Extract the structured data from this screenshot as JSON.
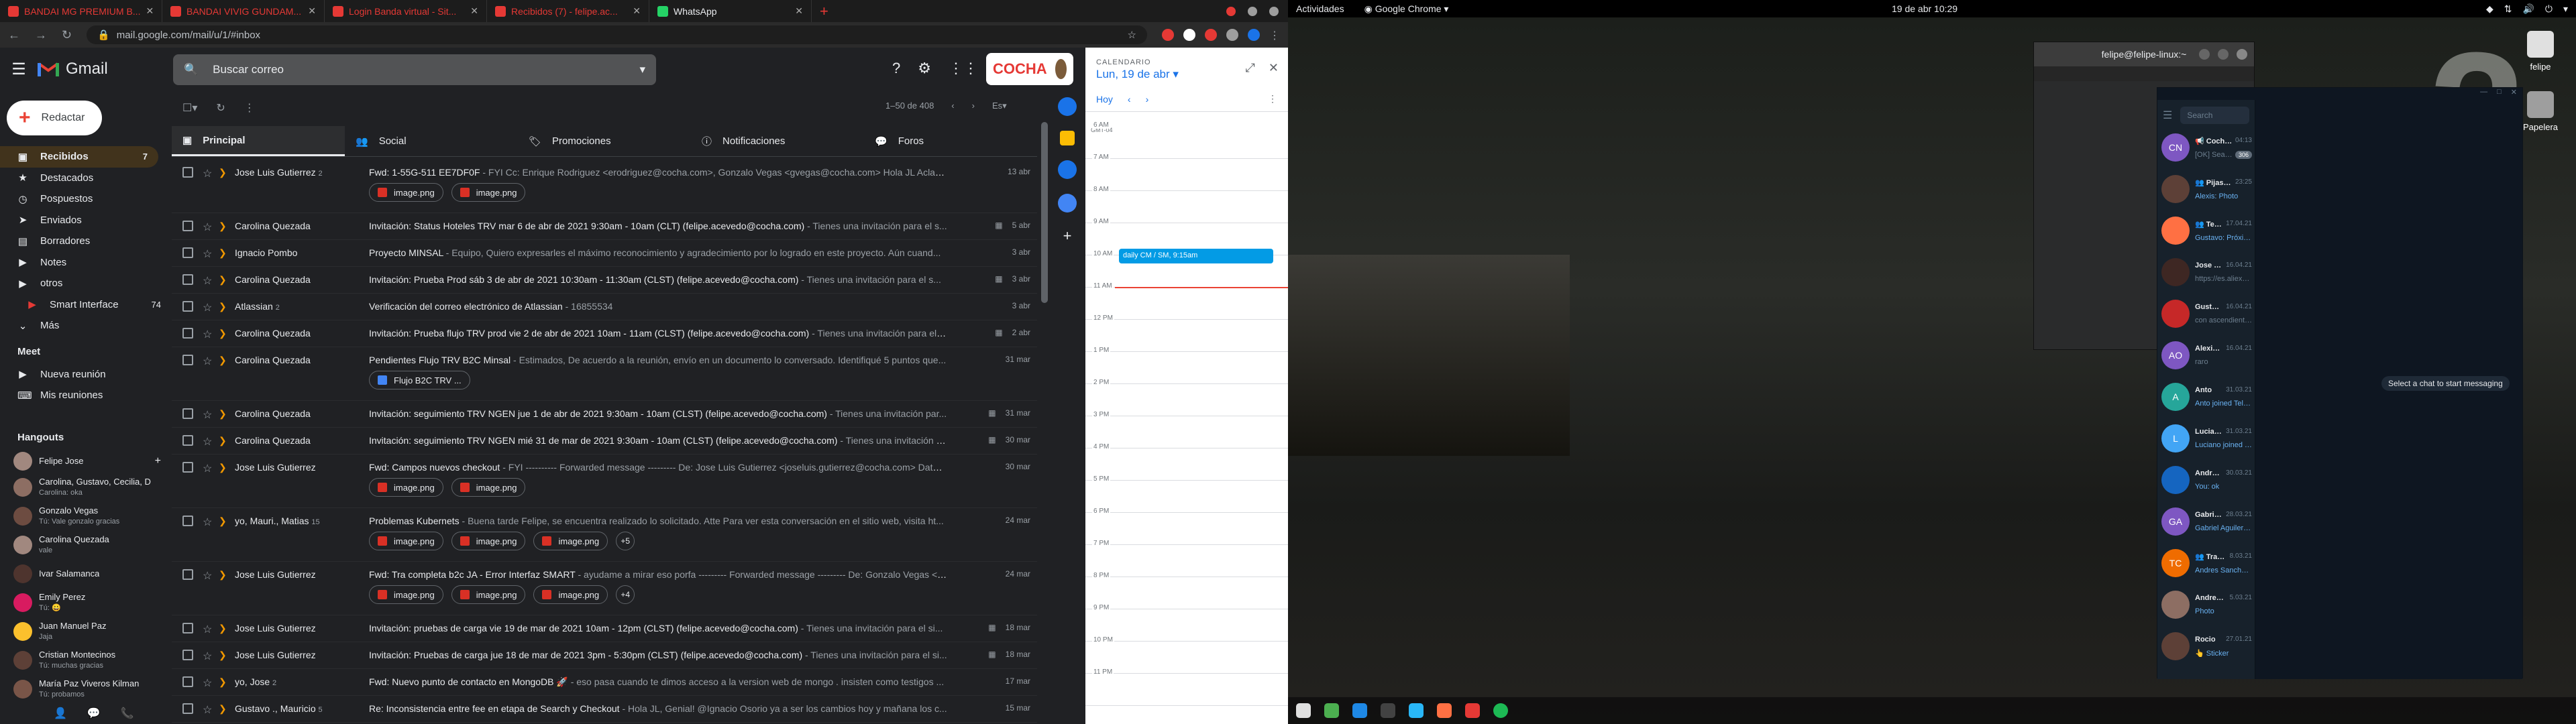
{
  "chrome": {
    "tabs": [
      {
        "label": "BANDAI MG PREMIUM B...",
        "color": "#e53935"
      },
      {
        "label": "BANDAI VIVIG GUNDAM...",
        "color": "#e53935"
      },
      {
        "label": "Login Banda virtual - Sit...",
        "color": "#e53935"
      },
      {
        "label": "Recibidos (7) - felipe.ac...",
        "color": "#e53935"
      },
      {
        "label": "WhatsApp",
        "color": "#25d366"
      }
    ],
    "new_tab": "+",
    "url": "mail.google.com/mail/u/1/#inbox"
  },
  "gmail": {
    "brand": "Gmail",
    "search_placeholder": "Buscar correo",
    "account_label": "COCHA",
    "compose": "Redactar",
    "nav": [
      {
        "label": "Recibidos",
        "icon": "inbox-icon",
        "count": "7",
        "active": true
      },
      {
        "label": "Destacados",
        "icon": "star-icon",
        "count": ""
      },
      {
        "label": "Pospuestos",
        "icon": "clock-icon",
        "count": ""
      },
      {
        "label": "Enviados",
        "icon": "send-icon",
        "count": ""
      },
      {
        "label": "Borradores",
        "icon": "draft-icon",
        "count": ""
      },
      {
        "label": "Notes",
        "icon": "label-icon",
        "count": ""
      },
      {
        "label": "otros",
        "icon": "label-icon",
        "count": ""
      },
      {
        "label": "Smart Interface",
        "icon": "label-red-icon",
        "count": "74"
      },
      {
        "label": "Más",
        "icon": "chevron-down-icon",
        "count": ""
      }
    ],
    "meet": {
      "title": "Meet",
      "items": [
        "Nueva reunión",
        "Mis reuniones"
      ]
    },
    "hangouts": {
      "title": "Hangouts",
      "user": "Felipe Jose",
      "contacts": [
        {
          "name": "Carolina, Gustavo, Cecilia, D",
          "status": "Carolina: oka",
          "color": "#8d6e63"
        },
        {
          "name": "Gonzalo Vegas",
          "status": "Tú: Vale gonzalo gracias",
          "color": "#6d4c41"
        },
        {
          "name": "Carolina Quezada",
          "status": "vale",
          "color": "#a1887f"
        },
        {
          "name": "Ivar Salamanca",
          "status": "",
          "color": "#4e342e"
        },
        {
          "name": "Emily Perez",
          "status": "Tú: 😀",
          "color": "#d81b60"
        },
        {
          "name": "Juan Manuel Paz",
          "status": "Jaja",
          "color": "#fbc02d"
        },
        {
          "name": "Cristian Montecinos",
          "status": "Tú: muchas gracias",
          "color": "#5d4037"
        },
        {
          "name": "María Paz Viveros Kilman",
          "status": "Tú: probamos",
          "color": "#795548"
        }
      ]
    },
    "pagination": "1–50 de 408",
    "categories": [
      {
        "label": "Principal",
        "active": true
      },
      {
        "label": "Social"
      },
      {
        "label": "Promociones"
      },
      {
        "label": "Notificaciones"
      },
      {
        "label": "Foros"
      }
    ],
    "emails": [
      {
        "from": "Jose Luis Gutierrez",
        "n": "2",
        "subject": "Fwd: 1-55G-511 EE7DF0F",
        "snippet": " - FYI Cc: Enrique Rodriguez <erodriguez@cocha.com>, Gonzalo Vegas <gvegas@cocha.com> Hola JL Aclarad...",
        "date": "13 abr",
        "atts": [
          "image.png",
          "image.png"
        ],
        "cal": false
      },
      {
        "from": "Carolina Quezada",
        "n": "",
        "subject": "Invitación: Status Hoteles TRV mar 6 de abr de 2021 9:30am - 10am (CLT) (felipe.acevedo@cocha.com)",
        "snippet": " - Tienes una invitación para el s...",
        "date": "5 abr",
        "atts": [],
        "cal": true
      },
      {
        "from": "Ignacio Pombo",
        "n": "",
        "subject": "Proyecto MINSAL",
        "snippet": " - Equipo, Quiero expresarles el máximo reconocimiento y agradecimiento por lo logrado en este proyecto. Aún cuand...",
        "date": "3 abr",
        "atts": [],
        "cal": false
      },
      {
        "from": "Carolina Quezada",
        "n": "",
        "subject": "Invitación: Prueba Prod sáb 3 de abr de 2021 10:30am - 11:30am (CLST) (felipe.acevedo@cocha.com)",
        "snippet": " - Tienes una invitación para el s...",
        "date": "3 abr",
        "atts": [],
        "cal": true
      },
      {
        "from": "Atlassian",
        "n": "2",
        "subject": "Verificación del correo electrónico de Atlassian",
        "snippet": " - 16855534",
        "date": "3 abr",
        "atts": [],
        "cal": false
      },
      {
        "from": "Carolina Quezada",
        "n": "",
        "subject": "Invitación: Prueba flujo TRV prod vie 2 de abr de 2021 10am - 11am (CLST) (felipe.acevedo@cocha.com)",
        "snippet": " - Tienes una invitación para el s...",
        "date": "2 abr",
        "atts": [],
        "cal": true
      },
      {
        "from": "Carolina Quezada",
        "n": "",
        "subject": "Pendientes Flujo TRV B2C Minsal",
        "snippet": " - Estimados, De acuerdo a la reunión, envío en un documento lo conversado. Identifiqué 5 puntos que...",
        "date": "31 mar",
        "atts": [
          "Flujo B2C TRV ..."
        ],
        "cal": false,
        "doc": true
      },
      {
        "from": "Carolina Quezada",
        "n": "",
        "subject": "Invitación: seguimiento TRV NGEN jue 1 de abr de 2021 9:30am - 10am (CLST) (felipe.acevedo@cocha.com)",
        "snippet": " - Tienes una invitación par...",
        "date": "31 mar",
        "atts": [],
        "cal": true
      },
      {
        "from": "Carolina Quezada",
        "n": "",
        "subject": "Invitación: seguimiento TRV NGEN mié 31 de mar de 2021 9:30am - 10am (CLST) (felipe.acevedo@cocha.com)",
        "snippet": " - Tienes una invitación para...",
        "date": "30 mar",
        "atts": [],
        "cal": true
      },
      {
        "from": "Jose Luis Gutierrez",
        "n": "",
        "subject": "Fwd: Campos nuevos checkout",
        "snippet": " - FYI ---------- Forwarded message --------- De: Jose Luis Gutierrez <joseluis.gutierrez@cocha.com> Date: m...",
        "date": "30 mar",
        "atts": [
          "image.png",
          "image.png"
        ],
        "cal": false
      },
      {
        "from": "yo, Mauri., Matias",
        "n": "15",
        "subject": "Problemas Kubernets",
        "snippet": " - Buena tarde Felipe, se encuentra realizado lo solicitado. Atte Para ver esta conversación en el sitio web, visita ht...",
        "date": "24 mar",
        "atts": [
          "image.png",
          "image.png",
          "image.png"
        ],
        "more": "+5",
        "cal": false
      },
      {
        "from": "Jose Luis Gutierrez",
        "n": "",
        "subject": "Fwd: Tra completa b2c JA - Error Interfaz SMART",
        "snippet": " - ayudame a mirar eso porfa --------- Forwarded message --------- De: Gonzalo Vegas <gv...",
        "date": "24 mar",
        "atts": [
          "image.png",
          "image.png",
          "image.png"
        ],
        "more": "+4",
        "cal": false
      },
      {
        "from": "Jose Luis Gutierrez",
        "n": "",
        "subject": "Invitación: pruebas de carga vie 19 de mar de 2021 10am - 12pm (CLST) (felipe.acevedo@cocha.com)",
        "snippet": " - Tienes una invitación para el si...",
        "date": "18 mar",
        "atts": [],
        "cal": true
      },
      {
        "from": "Jose Luis Gutierrez",
        "n": "",
        "subject": "Invitación: Pruebas de carga jue 18 de mar de 2021 3pm - 5:30pm (CLST) (felipe.acevedo@cocha.com)",
        "snippet": " - Tienes una invitación para el si...",
        "date": "18 mar",
        "atts": [],
        "cal": true
      },
      {
        "from": "yo, Jose",
        "n": "2",
        "subject": "Fwd: Nuevo punto de contacto en MongoDB 🚀",
        "snippet": " - eso pasa cuando te dimos acceso a la version web de mongo . insisten como testigos ...",
        "date": "17 mar",
        "atts": [],
        "cal": false
      },
      {
        "from": "Gustavo ., Mauricio",
        "n": "5",
        "subject": "Re: Inconsistencia entre fee en etapa de Search y Checkout",
        "snippet": " - Hola JL, Genial! @Ignacio Osorio ya a ser los cambios hoy y mañana los c...",
        "date": "15 mar",
        "atts": [],
        "cal": false
      }
    ]
  },
  "calendar": {
    "label": "CALENDARIO",
    "date": "Lun, 19 de abr",
    "today": "Hoy",
    "tz": "GMT-04",
    "hours": [
      "6 AM",
      "7 AM",
      "8 AM",
      "9 AM",
      "10 AM",
      "11 AM",
      "12 PM",
      "1 PM",
      "2 PM",
      "3 PM",
      "4 PM",
      "5 PM",
      "6 PM",
      "7 PM",
      "8 PM",
      "9 PM",
      "10 PM",
      "11 PM"
    ],
    "event": "daily CM / SM, 9:15am"
  },
  "desktop": {
    "activities": "Actividades",
    "app": "Google Chrome",
    "clock": "19 de abr  10:29",
    "home_label": "felipe",
    "trash_label": "Papelera",
    "terminal_title": "felipe@felipe-linux:~"
  },
  "telegram": {
    "search": "Search",
    "empty": "Select a chat to start messaging",
    "chats": [
      {
        "name": "Cocha Alerts Ngen",
        "prefix": "📢 ",
        "time": "04:13",
        "preview": "[OK] Search-manager - Stat...",
        "badge": "306",
        "initials": "CN",
        "color": "#7e57c2",
        "hl": false
      },
      {
        "name": "Pijas con mantequilla d...",
        "prefix": "👥 ",
        "time": "23:25",
        "preview": "Alexis: Photo",
        "initials": "",
        "color": "#5d4037",
        "hl": true
      },
      {
        "name": "Te doy vuelta el blai...",
        "prefix": "👥 ",
        "time": "17.04.21",
        "preview": "Gustavo: Próxima semana mejor",
        "initials": "",
        "color": "#ff7043",
        "hl": true
      },
      {
        "name": "Jose Luis",
        "prefix": "",
        "time": "16.04.21",
        "preview": "https://es.aliexpress.com/item/40...",
        "initials": "",
        "color": "#3e2723",
        "hl": false
      },
      {
        "name": "Gustavo Vivallos",
        "prefix": "",
        "time": "16.04.21",
        "preview": "con ascendientes, cromatico, me...",
        "initials": "",
        "color": "#c62828",
        "hl": false
      },
      {
        "name": "Alexis Osorio",
        "prefix": "",
        "time": "16.04.21",
        "preview": "raro",
        "initials": "AO",
        "color": "#7e57c2",
        "hl": false
      },
      {
        "name": "Anto",
        "prefix": "",
        "time": "31.03.21",
        "preview": "Anto joined Telegram",
        "initials": "A",
        "color": "#26a69a",
        "hl": true
      },
      {
        "name": "Luciano",
        "prefix": "",
        "time": "31.03.21",
        "preview": "Luciano joined Telegram",
        "initials": "L",
        "color": "#42a5f5",
        "hl": true
      },
      {
        "name": "Andres Sanchez",
        "prefix": "",
        "time": "30.03.21",
        "preview": "You: ok",
        "initials": "",
        "color": "#1565c0",
        "hl": true
      },
      {
        "name": "Gabriel Aguilera Afp Mo...",
        "prefix": "",
        "time": "28.03.21",
        "preview": "Gabriel Aguilera Afp Modelo Astra...",
        "initials": "GA",
        "color": "#7e57c2",
        "hl": true
      },
      {
        "name": "Trabajo cocha",
        "prefix": "👥 ",
        "time": "8.03.21",
        "preview": "Andres Sanchez left the group",
        "initials": "TC",
        "color": "#ef6c00",
        "hl": true
      },
      {
        "name": "Andres Nory",
        "prefix": "",
        "time": "5.03.21",
        "preview": "Photo",
        "initials": "",
        "color": "#8d6e63",
        "hl": true
      },
      {
        "name": "Rocio",
        "prefix": "",
        "time": "27.01.21",
        "preview": "👆 Sticker",
        "initials": "",
        "color": "#5d4037",
        "hl": true
      }
    ]
  }
}
